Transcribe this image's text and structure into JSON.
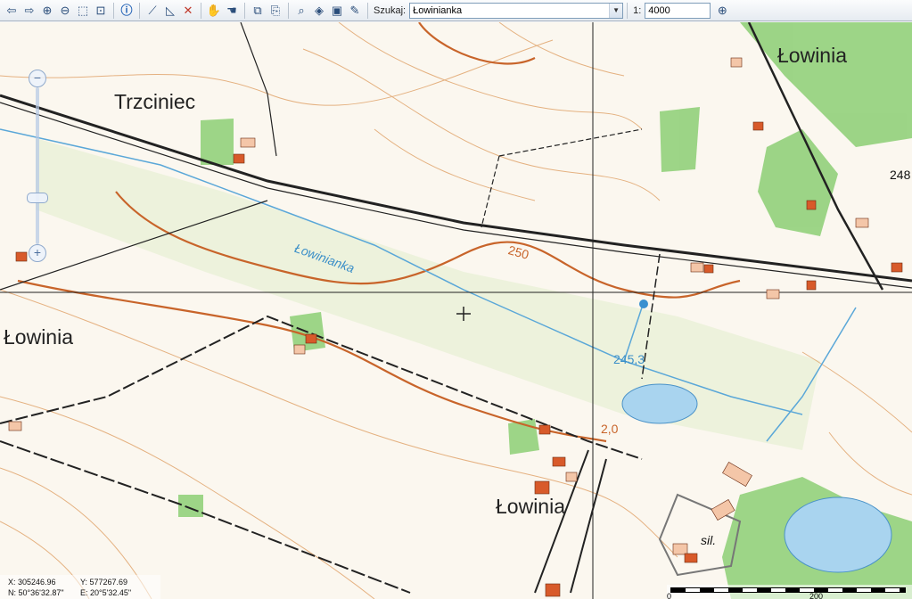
{
  "toolbar": {
    "search_label": "Szukaj:",
    "search_value": "Łowinianka",
    "scale_prefix": "1:",
    "scale_value": "4000"
  },
  "map": {
    "labels": {
      "trzciniec": "Trzciniec",
      "lowinia_ne": "Łowinia",
      "lowinia_w": "Łowinia",
      "lowinia_s": "Łowinia",
      "river": "Łowinianka",
      "elev_250": "250",
      "elev_2453": "245,3",
      "elev_248": "248",
      "elev_2": "2,0",
      "sil": "sil."
    },
    "colors": {
      "background": "#fbf7ef",
      "contour": "#d9823a",
      "water": "#5aa7d8",
      "forest": "#7cc86a",
      "building": "#d85a2a",
      "road": "#222222"
    }
  },
  "coords": {
    "x": "X: 305246.96",
    "y": "Y: 577267.69",
    "n": "N: 50°36'32.87\"",
    "e": "E: 20°5'32.45\""
  },
  "scalebar": {
    "label_zero": "0",
    "label_200": "200"
  }
}
